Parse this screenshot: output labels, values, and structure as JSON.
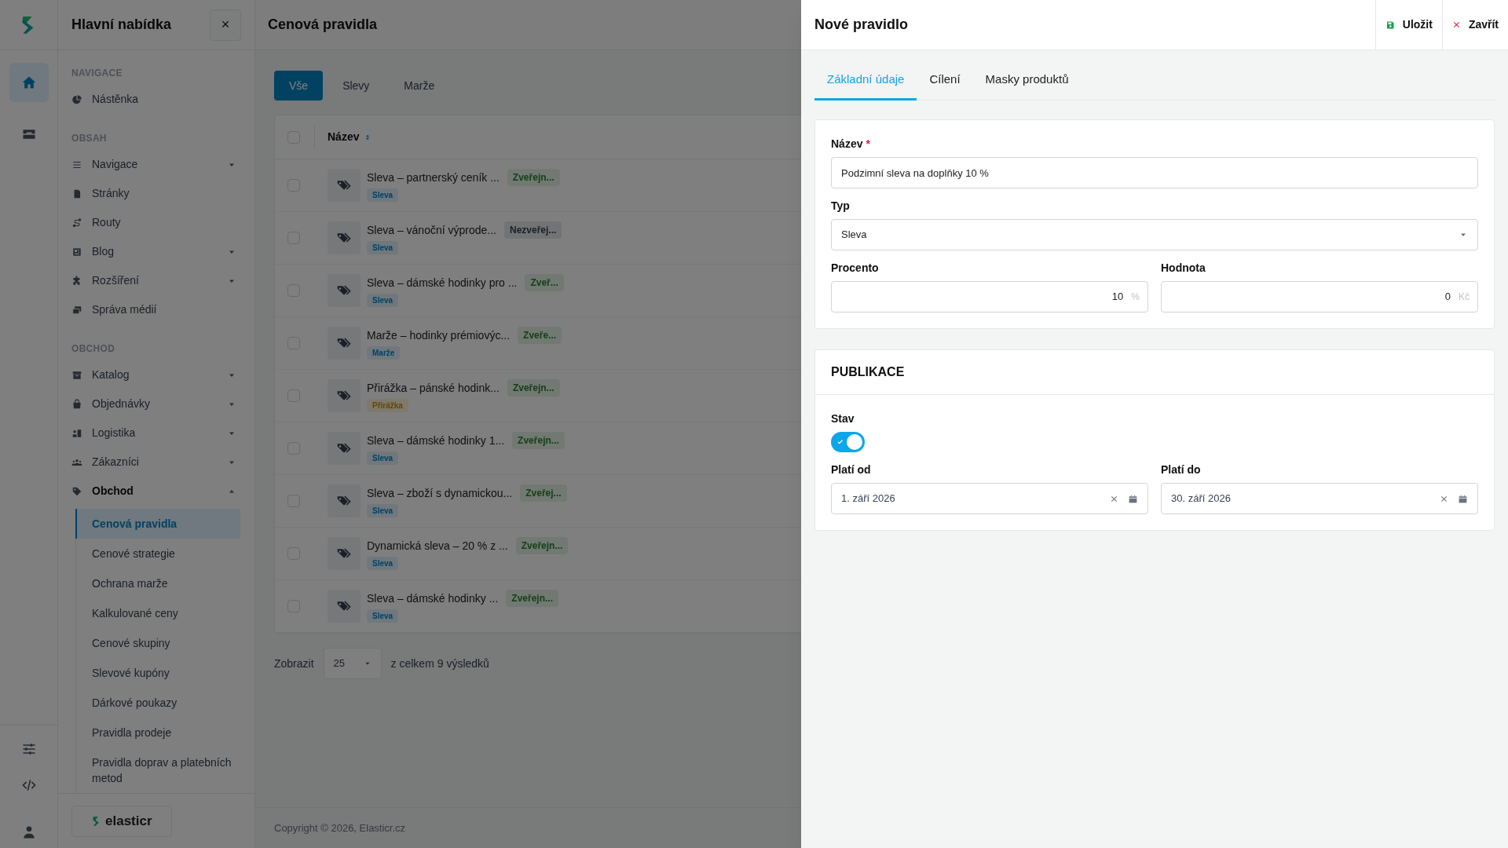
{
  "rail": {
    "items": [
      {
        "selected": true
      },
      {
        "selected": false
      }
    ]
  },
  "sidebar": {
    "title": "Hlavní nabídka",
    "close": "×",
    "sections": [
      {
        "heading": "NAVIGACE",
        "items": [
          {
            "label": "Nástěnka",
            "kind": "link"
          }
        ]
      },
      {
        "heading": "OBSAH",
        "items": [
          {
            "label": "Navigace",
            "kind": "group",
            "expanded": false
          },
          {
            "label": "Stránky",
            "kind": "link"
          },
          {
            "label": "Routy",
            "kind": "link"
          },
          {
            "label": "Blog",
            "kind": "group",
            "expanded": false
          },
          {
            "label": "Rozšíření",
            "kind": "group",
            "expanded": false
          },
          {
            "label": "Správa médií",
            "kind": "link"
          }
        ]
      },
      {
        "heading": "OBCHOD",
        "items": [
          {
            "label": "Katalog",
            "kind": "group",
            "expanded": false
          },
          {
            "label": "Objednávky",
            "kind": "group",
            "expanded": false
          },
          {
            "label": "Logistika",
            "kind": "group",
            "expanded": false
          },
          {
            "label": "Zákazníci",
            "kind": "group",
            "expanded": false
          },
          {
            "label": "Obchod",
            "kind": "group",
            "expanded": true,
            "children": [
              {
                "label": "Cenová pravidla",
                "selected": true
              },
              {
                "label": "Cenové strategie",
                "selected": false
              },
              {
                "label": "Ochrana marže",
                "selected": false
              },
              {
                "label": "Kalkulované ceny",
                "selected": false
              },
              {
                "label": "Cenové skupiny",
                "selected": false
              },
              {
                "label": "Slevové kupóny",
                "selected": false
              },
              {
                "label": "Dárkové poukazy",
                "selected": false
              },
              {
                "label": "Pravidla prodeje",
                "selected": false
              },
              {
                "label": "Pravidla doprav a platebních metod",
                "selected": false
              }
            ]
          }
        ]
      }
    ],
    "brand": "elasticr"
  },
  "page": {
    "title": "Cenová pravidla",
    "filters": [
      {
        "label": "Vše",
        "selected": true
      },
      {
        "label": "Slevy",
        "selected": false
      },
      {
        "label": "Marže",
        "selected": false
      }
    ],
    "table": {
      "column": "Název",
      "all_checked": false,
      "rows": [
        {
          "checked": false,
          "title": "Sleva – partnerský ceník ...",
          "status": {
            "text": "Zveřejn...",
            "kind": "published"
          },
          "tag": {
            "text": "Sleva",
            "kind": "discount"
          }
        },
        {
          "checked": false,
          "title": "Sleva – vánoční výprode...",
          "status": {
            "text": "Nezveřej...",
            "kind": "unpublished"
          },
          "tag": {
            "text": "Sleva",
            "kind": "discount"
          }
        },
        {
          "checked": false,
          "title": "Sleva – dámské hodinky pro ...",
          "status": {
            "text": "Zveř...",
            "kind": "published"
          },
          "tag": {
            "text": "Sleva",
            "kind": "discount"
          }
        },
        {
          "checked": false,
          "title": "Marže – hodinky prémiovýc...",
          "status": {
            "text": "Zveře...",
            "kind": "published"
          },
          "tag": {
            "text": "Marže",
            "kind": "margin"
          }
        },
        {
          "checked": false,
          "title": "Přirážka – pánské hodink...",
          "status": {
            "text": "Zveřejn...",
            "kind": "published"
          },
          "tag": {
            "text": "Přirážka",
            "kind": "surcharge"
          }
        },
        {
          "checked": false,
          "title": "Sleva – dámské hodinky 1...",
          "status": {
            "text": "Zveřejn...",
            "kind": "published"
          },
          "tag": {
            "text": "Sleva",
            "kind": "discount"
          }
        },
        {
          "checked": false,
          "title": "Sleva – zboží s dynamickou...",
          "status": {
            "text": "Zveřej...",
            "kind": "published"
          },
          "tag": {
            "text": "Sleva",
            "kind": "discount"
          }
        },
        {
          "checked": false,
          "title": "Dynamická sleva – 20 % z ...",
          "status": {
            "text": "Zveřejn...",
            "kind": "published"
          },
          "tag": {
            "text": "Sleva",
            "kind": "discount"
          }
        },
        {
          "checked": false,
          "title": "Sleva – dámské hodinky ...",
          "status": {
            "text": "Zveřejn...",
            "kind": "published"
          },
          "tag": {
            "text": "Sleva",
            "kind": "discount"
          }
        }
      ]
    },
    "pagination": {
      "label": "Zobrazit",
      "per_page": "25",
      "total": "z celkem 9 výsledků"
    },
    "footer": "Copyright © 2026, Elasticr.cz"
  },
  "drawer": {
    "title": "Nové pravidlo",
    "actions": [
      {
        "label": "Uložit",
        "kind": "save"
      },
      {
        "label": "Zavřít",
        "kind": "close"
      }
    ],
    "tabs": [
      {
        "label": "Základní údaje",
        "selected": true
      },
      {
        "label": "Cílení",
        "selected": false
      },
      {
        "label": "Masky produktů",
        "selected": false
      }
    ],
    "basic": {
      "name": {
        "label": "Název",
        "required_mark": "*",
        "value": "Podzimní sleva na doplňky 10 %"
      },
      "type": {
        "label": "Typ",
        "value": "Sleva"
      },
      "percent": {
        "label": "Procento",
        "value": "10",
        "unit": "%"
      },
      "amount": {
        "label": "Hodnota",
        "value": "0",
        "unit": "Kč"
      }
    },
    "publication": {
      "heading": "PUBLIKACE",
      "status": {
        "label": "Stav",
        "on": true
      },
      "valid_from": {
        "label": "Platí od",
        "value": "1. září 2026"
      },
      "valid_to": {
        "label": "Platí do",
        "value": "30. září 2026"
      }
    }
  }
}
